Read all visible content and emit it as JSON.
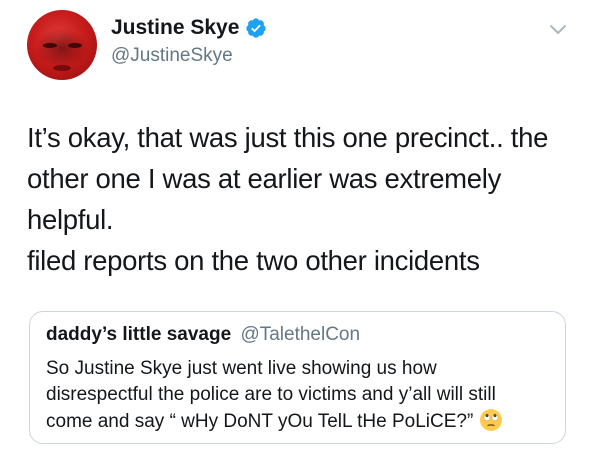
{
  "author": {
    "display_name": "Justine Skye",
    "handle": "@JustineSkye",
    "verified": true,
    "avatar_color": "#c81c1c"
  },
  "tweet": {
    "lines": [
      "It’s okay, that was just this one precinct.. the",
      "other one I was at earlier was extremely",
      "helpful.",
      "filed reports on the two other incidents"
    ]
  },
  "quote": {
    "display_name": "daddy’s little savage",
    "handle": "@TalethelCon",
    "lines": [
      "So Justine Skye just went live showing us how",
      "disrespectful the police are to victims and y’all will still",
      "come and say “ wHy DoNT yOu TelL tHe PoLiCE?”"
    ],
    "emoji": "face-with-rolling-eyes"
  },
  "colors": {
    "text": "#14171a",
    "secondary": "#657786",
    "verified_badge": "#1da1f2",
    "border": "#ccd6dd"
  }
}
